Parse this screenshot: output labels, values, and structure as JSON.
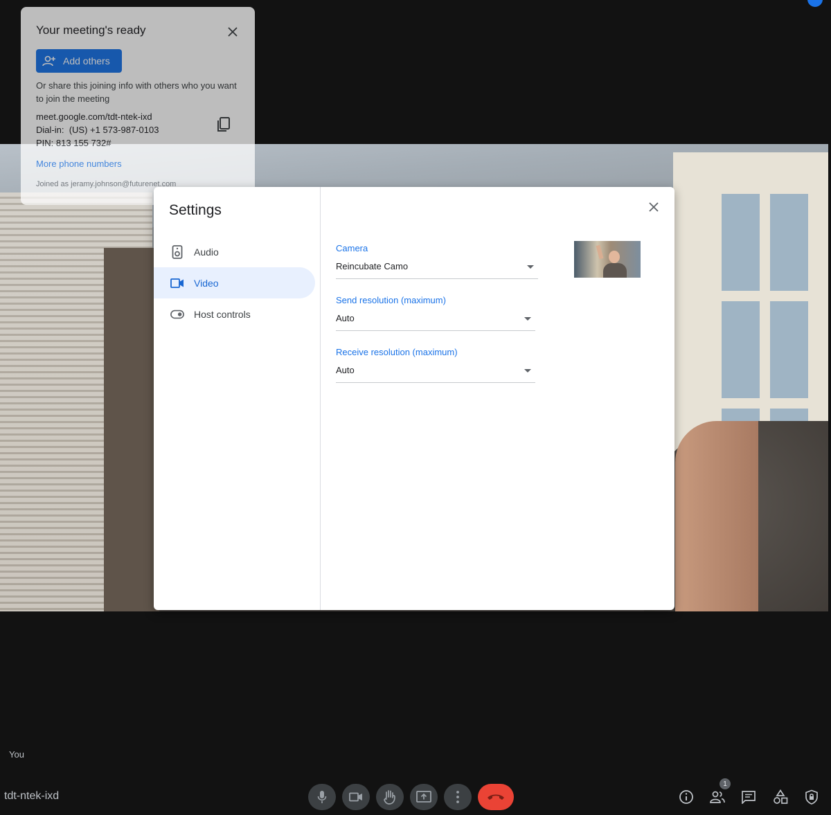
{
  "ready_card": {
    "title": "Your meeting's ready",
    "add_label": "Add others",
    "share_text": "Or share this joining info with others who you want to join the meeting",
    "meeting_link": "meet.google.com/tdt-ntek-ixd",
    "dialin_label": "Dial-in:",
    "dialin_value": "(US) +1 573-987-0103",
    "pin_label": "PIN:",
    "pin_value": "813 155 732#",
    "more_phone": "More phone numbers",
    "joined_as": "Joined as jeramy.johnson@futurenet.com"
  },
  "settings": {
    "title": "Settings",
    "nav": [
      {
        "label": "Audio",
        "icon": "speaker-icon",
        "active": false
      },
      {
        "label": "Video",
        "icon": "videocam-icon",
        "active": true
      },
      {
        "label": "Host controls",
        "icon": "toggle-icon",
        "active": false
      }
    ],
    "camera": {
      "label": "Camera",
      "value": "Reincubate Camo"
    },
    "send_resolution": {
      "label": "Send resolution (maximum)",
      "value": "Auto"
    },
    "receive_resolution": {
      "label": "Receive resolution (maximum)",
      "value": "Auto"
    }
  },
  "bottom": {
    "you_label": "You",
    "meeting_code": "tdt-ntek-ixd",
    "controls": [
      "microphone-icon",
      "camera-icon",
      "raise-hand-icon",
      "present-screen-icon",
      "more-options-icon",
      "end-call-icon"
    ],
    "right_icons": [
      "info-icon",
      "people-icon",
      "chat-icon",
      "activities-icon",
      "host-controls-icon"
    ],
    "people_count": "1"
  },
  "colors": {
    "accent": "#1a73e8",
    "end_call": "#ea4335",
    "background": "#121212",
    "nav_active_bg": "#e8f0fe"
  }
}
